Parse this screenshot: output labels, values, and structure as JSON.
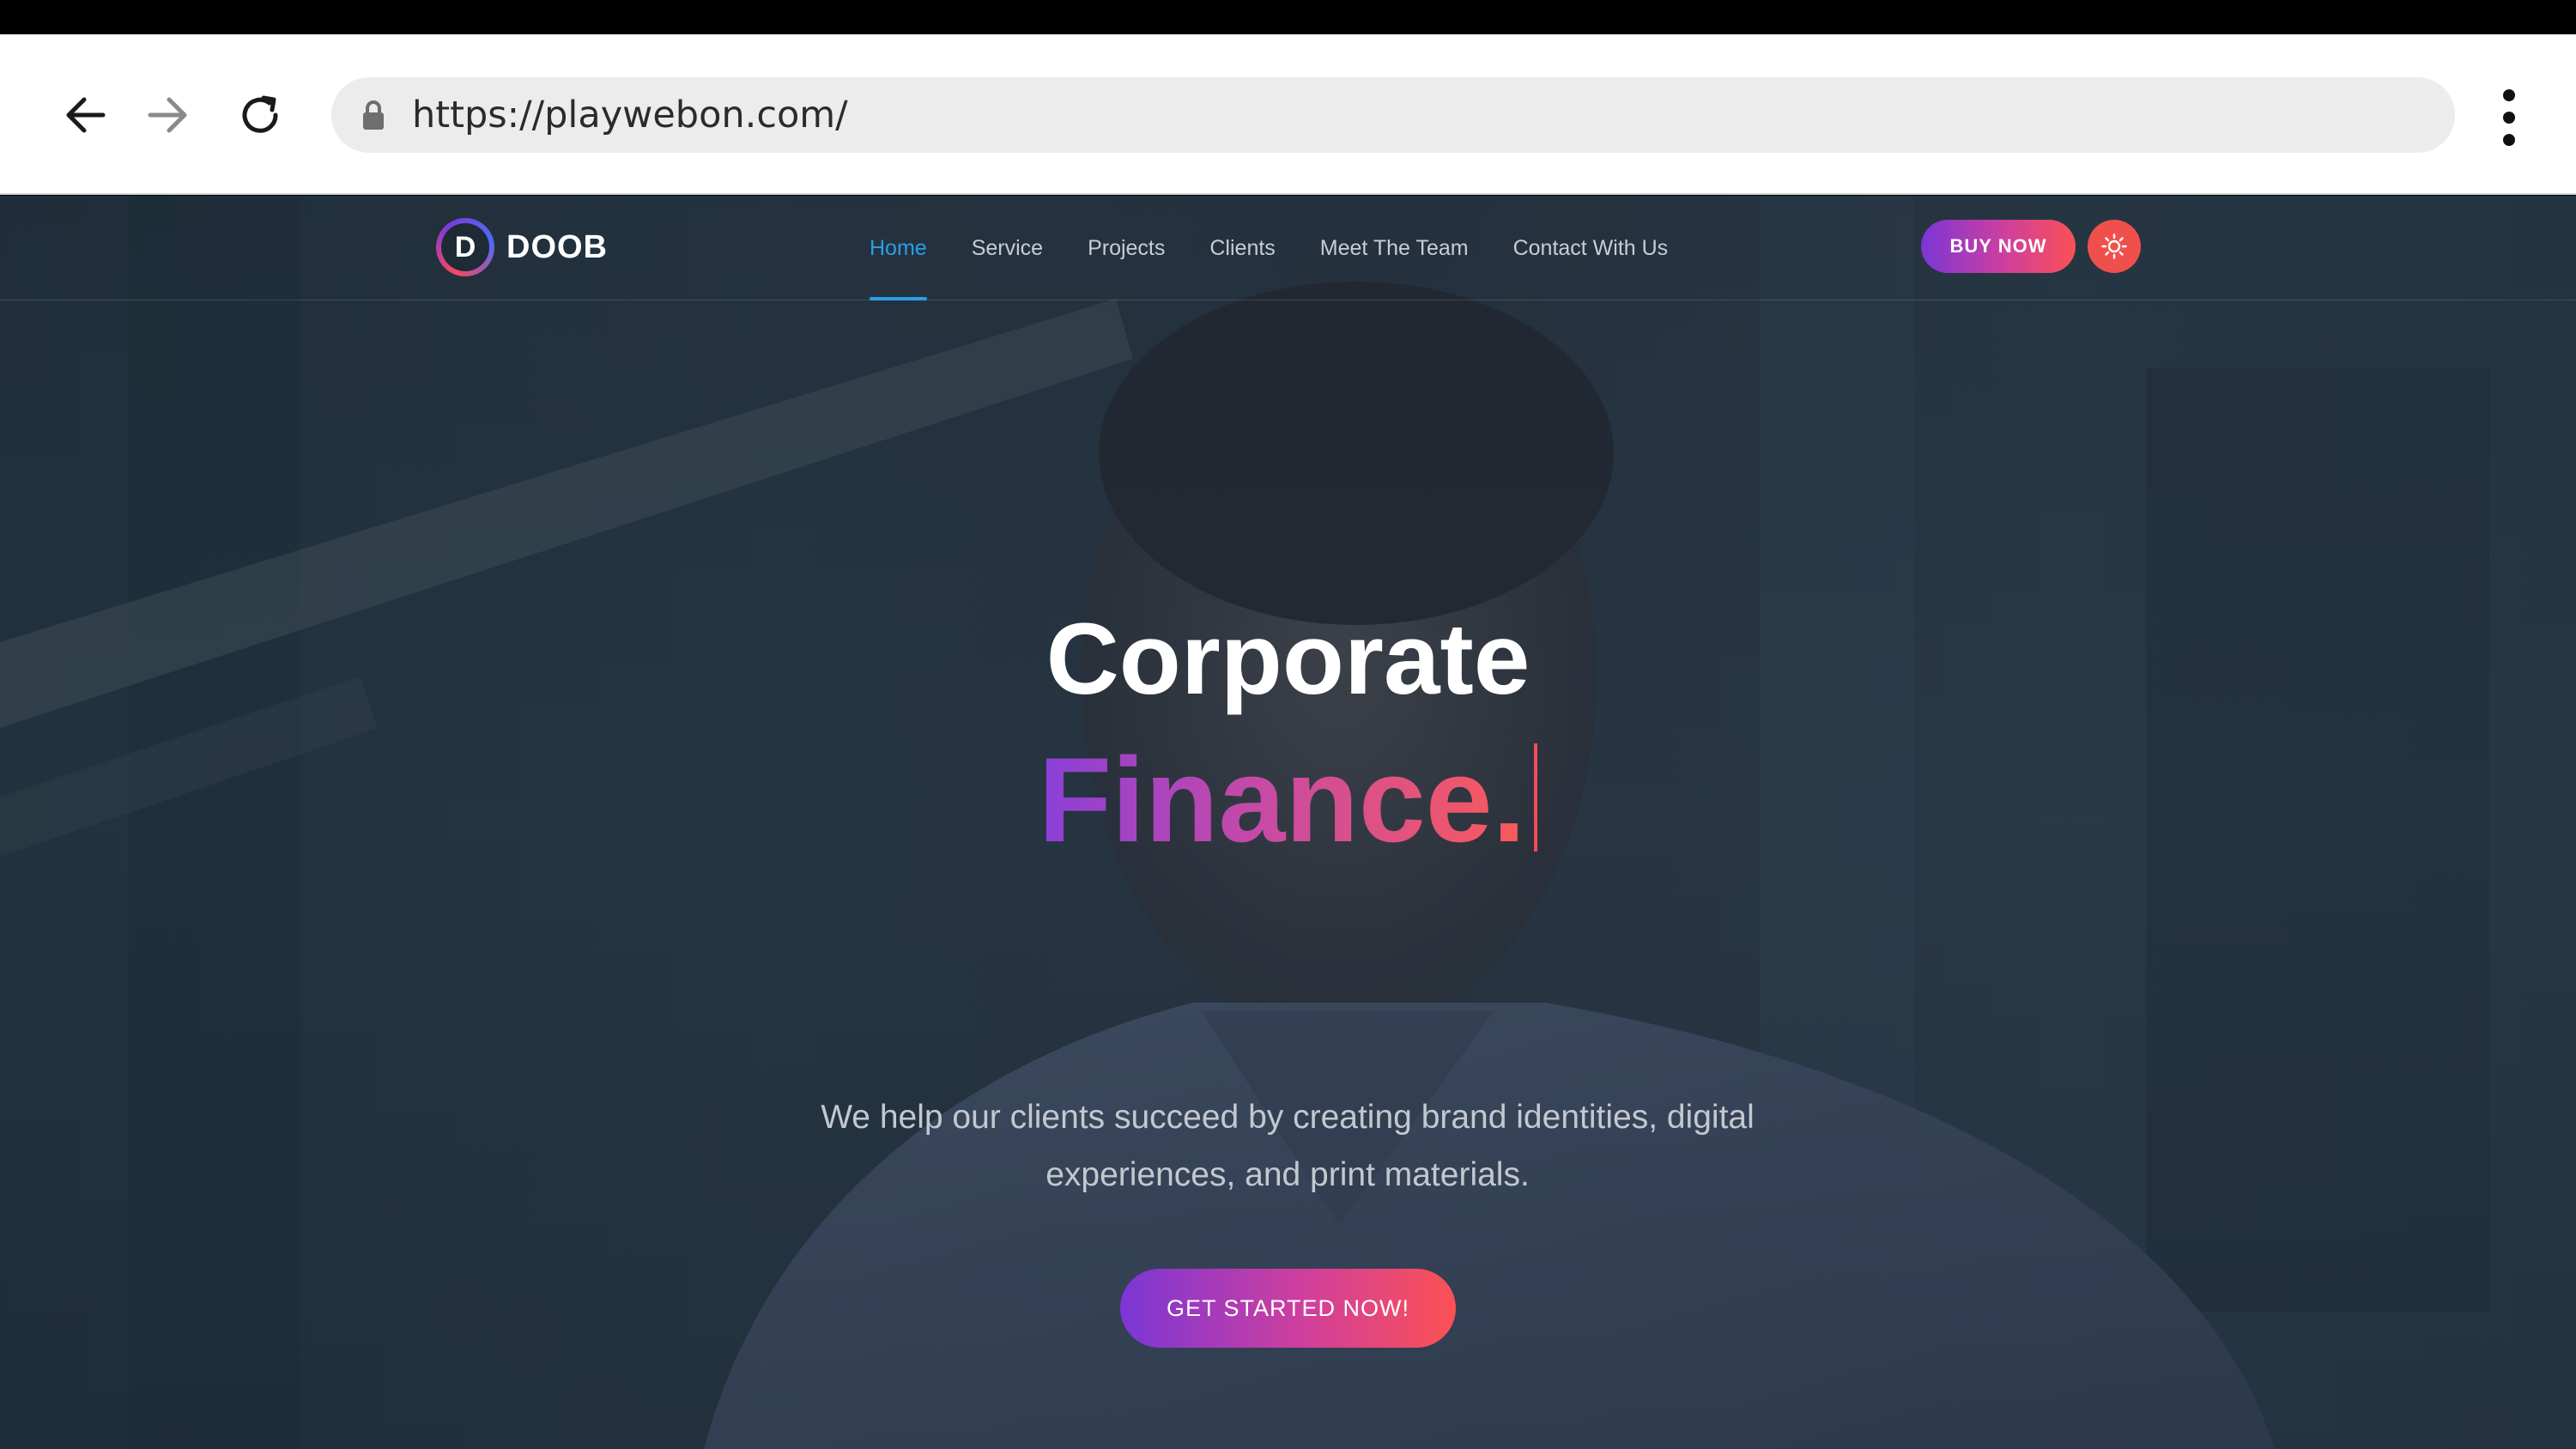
{
  "browser": {
    "url": "https://playwebon.com/",
    "icons": {
      "back": "arrow-left-icon",
      "forward": "arrow-right-icon",
      "reload": "reload-icon",
      "lock": "lock-icon",
      "menu": "kebab-menu-icon"
    }
  },
  "site": {
    "logo_letter": "D",
    "logo_text": "DOOB",
    "nav": [
      {
        "label": "Home",
        "active": true
      },
      {
        "label": "Service",
        "active": false
      },
      {
        "label": "Projects",
        "active": false
      },
      {
        "label": "Clients",
        "active": false
      },
      {
        "label": "Meet The Team",
        "active": false
      },
      {
        "label": "Contact With Us",
        "active": false
      }
    ],
    "buy_label": "BUY NOW",
    "theme_icon": "sun-icon"
  },
  "hero": {
    "title": "Corporate",
    "accent": "Finance.",
    "description": "We help our clients succeed by creating brand identities, digital experiences, and print materials.",
    "cta_label": "GET STARTED NOW!"
  },
  "colors": {
    "nav_active": "#2b9de9",
    "gradient_start": "#7b36d6",
    "gradient_end": "#fb5153",
    "theme_button": "#f0504c"
  }
}
